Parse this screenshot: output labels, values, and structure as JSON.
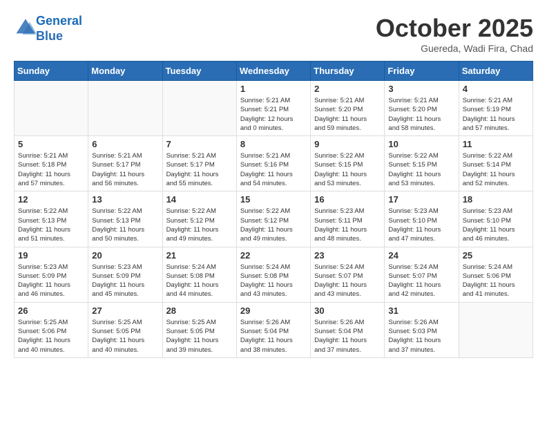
{
  "header": {
    "logo_line1": "General",
    "logo_line2": "Blue",
    "month": "October 2025",
    "location": "Guereda, Wadi Fira, Chad"
  },
  "weekdays": [
    "Sunday",
    "Monday",
    "Tuesday",
    "Wednesday",
    "Thursday",
    "Friday",
    "Saturday"
  ],
  "weeks": [
    [
      {
        "day": "",
        "info": ""
      },
      {
        "day": "",
        "info": ""
      },
      {
        "day": "",
        "info": ""
      },
      {
        "day": "1",
        "info": "Sunrise: 5:21 AM\nSunset: 5:21 PM\nDaylight: 12 hours\nand 0 minutes."
      },
      {
        "day": "2",
        "info": "Sunrise: 5:21 AM\nSunset: 5:20 PM\nDaylight: 11 hours\nand 59 minutes."
      },
      {
        "day": "3",
        "info": "Sunrise: 5:21 AM\nSunset: 5:20 PM\nDaylight: 11 hours\nand 58 minutes."
      },
      {
        "day": "4",
        "info": "Sunrise: 5:21 AM\nSunset: 5:19 PM\nDaylight: 11 hours\nand 57 minutes."
      }
    ],
    [
      {
        "day": "5",
        "info": "Sunrise: 5:21 AM\nSunset: 5:18 PM\nDaylight: 11 hours\nand 57 minutes."
      },
      {
        "day": "6",
        "info": "Sunrise: 5:21 AM\nSunset: 5:17 PM\nDaylight: 11 hours\nand 56 minutes."
      },
      {
        "day": "7",
        "info": "Sunrise: 5:21 AM\nSunset: 5:17 PM\nDaylight: 11 hours\nand 55 minutes."
      },
      {
        "day": "8",
        "info": "Sunrise: 5:21 AM\nSunset: 5:16 PM\nDaylight: 11 hours\nand 54 minutes."
      },
      {
        "day": "9",
        "info": "Sunrise: 5:22 AM\nSunset: 5:15 PM\nDaylight: 11 hours\nand 53 minutes."
      },
      {
        "day": "10",
        "info": "Sunrise: 5:22 AM\nSunset: 5:15 PM\nDaylight: 11 hours\nand 53 minutes."
      },
      {
        "day": "11",
        "info": "Sunrise: 5:22 AM\nSunset: 5:14 PM\nDaylight: 11 hours\nand 52 minutes."
      }
    ],
    [
      {
        "day": "12",
        "info": "Sunrise: 5:22 AM\nSunset: 5:13 PM\nDaylight: 11 hours\nand 51 minutes."
      },
      {
        "day": "13",
        "info": "Sunrise: 5:22 AM\nSunset: 5:13 PM\nDaylight: 11 hours\nand 50 minutes."
      },
      {
        "day": "14",
        "info": "Sunrise: 5:22 AM\nSunset: 5:12 PM\nDaylight: 11 hours\nand 49 minutes."
      },
      {
        "day": "15",
        "info": "Sunrise: 5:22 AM\nSunset: 5:12 PM\nDaylight: 11 hours\nand 49 minutes."
      },
      {
        "day": "16",
        "info": "Sunrise: 5:23 AM\nSunset: 5:11 PM\nDaylight: 11 hours\nand 48 minutes."
      },
      {
        "day": "17",
        "info": "Sunrise: 5:23 AM\nSunset: 5:10 PM\nDaylight: 11 hours\nand 47 minutes."
      },
      {
        "day": "18",
        "info": "Sunrise: 5:23 AM\nSunset: 5:10 PM\nDaylight: 11 hours\nand 46 minutes."
      }
    ],
    [
      {
        "day": "19",
        "info": "Sunrise: 5:23 AM\nSunset: 5:09 PM\nDaylight: 11 hours\nand 46 minutes."
      },
      {
        "day": "20",
        "info": "Sunrise: 5:23 AM\nSunset: 5:09 PM\nDaylight: 11 hours\nand 45 minutes."
      },
      {
        "day": "21",
        "info": "Sunrise: 5:24 AM\nSunset: 5:08 PM\nDaylight: 11 hours\nand 44 minutes."
      },
      {
        "day": "22",
        "info": "Sunrise: 5:24 AM\nSunset: 5:08 PM\nDaylight: 11 hours\nand 43 minutes."
      },
      {
        "day": "23",
        "info": "Sunrise: 5:24 AM\nSunset: 5:07 PM\nDaylight: 11 hours\nand 43 minutes."
      },
      {
        "day": "24",
        "info": "Sunrise: 5:24 AM\nSunset: 5:07 PM\nDaylight: 11 hours\nand 42 minutes."
      },
      {
        "day": "25",
        "info": "Sunrise: 5:24 AM\nSunset: 5:06 PM\nDaylight: 11 hours\nand 41 minutes."
      }
    ],
    [
      {
        "day": "26",
        "info": "Sunrise: 5:25 AM\nSunset: 5:06 PM\nDaylight: 11 hours\nand 40 minutes."
      },
      {
        "day": "27",
        "info": "Sunrise: 5:25 AM\nSunset: 5:05 PM\nDaylight: 11 hours\nand 40 minutes."
      },
      {
        "day": "28",
        "info": "Sunrise: 5:25 AM\nSunset: 5:05 PM\nDaylight: 11 hours\nand 39 minutes."
      },
      {
        "day": "29",
        "info": "Sunrise: 5:26 AM\nSunset: 5:04 PM\nDaylight: 11 hours\nand 38 minutes."
      },
      {
        "day": "30",
        "info": "Sunrise: 5:26 AM\nSunset: 5:04 PM\nDaylight: 11 hours\nand 37 minutes."
      },
      {
        "day": "31",
        "info": "Sunrise: 5:26 AM\nSunset: 5:03 PM\nDaylight: 11 hours\nand 37 minutes."
      },
      {
        "day": "",
        "info": ""
      }
    ]
  ]
}
